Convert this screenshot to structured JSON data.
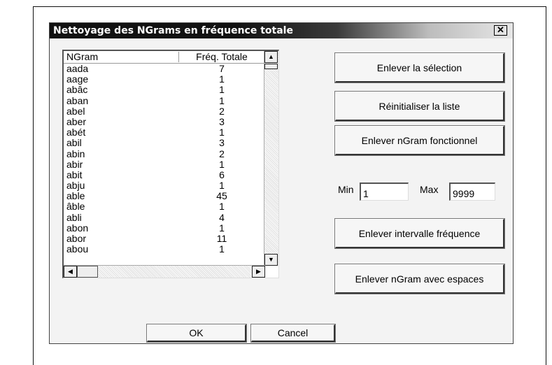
{
  "window": {
    "title": "Nettoyage des NGrams en fréquence totale",
    "close_icon": "close-icon"
  },
  "list": {
    "columns": [
      "NGram",
      "Fréq. Totale"
    ],
    "rows": [
      [
        "aada",
        "7"
      ],
      [
        "aage",
        "1"
      ],
      [
        "abâc",
        "1"
      ],
      [
        "aban",
        "1"
      ],
      [
        "abel",
        "2"
      ],
      [
        "aber",
        "3"
      ],
      [
        "abét",
        "1"
      ],
      [
        "abil",
        "3"
      ],
      [
        "abin",
        "2"
      ],
      [
        "abir",
        "1"
      ],
      [
        "abit",
        "6"
      ],
      [
        "abju",
        "1"
      ],
      [
        "able",
        "45"
      ],
      [
        "âble",
        "1"
      ],
      [
        "abli",
        "4"
      ],
      [
        "abon",
        "1"
      ],
      [
        "abor",
        "11"
      ],
      [
        "abou",
        "1"
      ]
    ]
  },
  "buttons": {
    "remove_selection": "Enlever la sélection",
    "reset_list": "Réinitialiser la liste",
    "remove_functional": "Enlever nGram fonctionnel",
    "remove_interval": "Enlever intervalle fréquence",
    "remove_spaces": "Enlever nGram avec espaces",
    "ok": "OK",
    "cancel": "Cancel"
  },
  "range": {
    "min_label": "Min",
    "min_value": "1",
    "max_label": "Max",
    "max_value": "9999"
  }
}
